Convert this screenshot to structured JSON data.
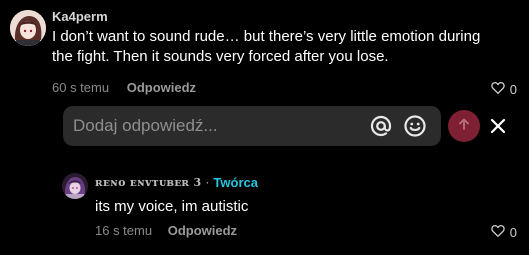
{
  "comment": {
    "username": "Ka4perm",
    "text": "I don’t want to sound rude… but there’s very little emotion during the fight. Then it sounds very forced after you lose.",
    "time": "60 s temu",
    "reply_label": "Odpowiedz",
    "like_count": "0"
  },
  "reply_box": {
    "placeholder": "Dodaj odpowiedź..."
  },
  "reply": {
    "username": "ʀᴇɴᴏ ᴇɴᴠᴛᴜʙᴇʀ 3",
    "separator": "·",
    "creator_label": "Twórca",
    "text": "its my voice, im autistic",
    "time": "16 s temu",
    "reply_label": "Odpowiedz",
    "like_count": "0"
  },
  "colors": {
    "background": "#000000",
    "creator_accent": "#25c7e0",
    "send_button": "#7e1f33",
    "input_background": "#2b2b2b"
  }
}
